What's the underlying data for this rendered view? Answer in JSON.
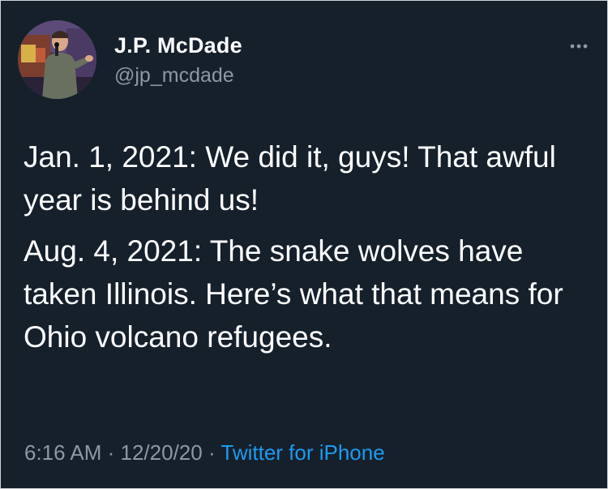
{
  "author": {
    "display_name": "J.P. McDade",
    "handle": "@jp_mcdade"
  },
  "icons": {
    "avatar": "avatar-photo",
    "more": "more-options-icon"
  },
  "tweet": {
    "paragraphs": [
      "Jan. 1, 2021: We did it, guys! That awful year is behind us!",
      "Aug. 4, 2021: The snake wolves have taken Illinois. Here’s what that means for Ohio volcano refugees."
    ]
  },
  "meta": {
    "time": "6:16 AM",
    "separator": " · ",
    "date": "12/20/20",
    "source": "Twitter for iPhone"
  },
  "colors": {
    "background": "#15202b",
    "primary_text": "#ffffff",
    "secondary_text": "#8b98a5",
    "link": "#1d9bf0"
  }
}
